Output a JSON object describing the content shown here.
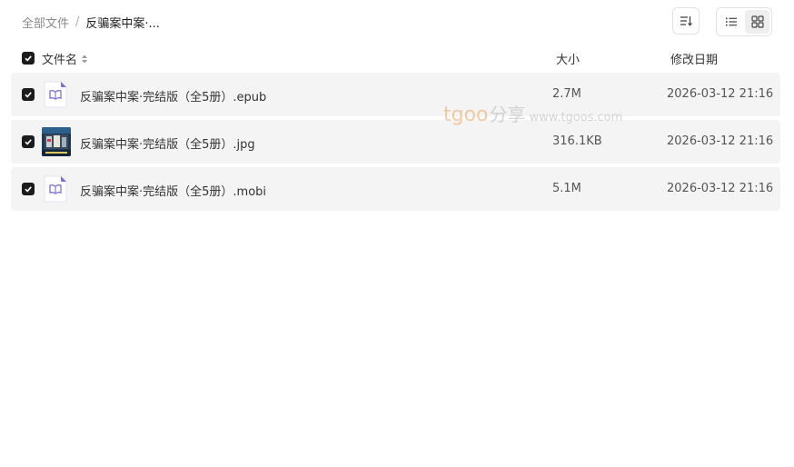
{
  "breadcrumb": {
    "root": "全部文件",
    "separator": "/",
    "current": "反骗案中案·..."
  },
  "toolbar": {
    "sort_icon": "sort-icon",
    "list_view_icon": "list-view-icon",
    "grid_view_icon": "grid-view-icon"
  },
  "header": {
    "name": "文件名",
    "size": "大小",
    "date": "修改日期"
  },
  "files": [
    {
      "name": "反骗案中案·完结版（全5册）.epub",
      "size": "2.7M",
      "modified": "2026-03-12 21:16",
      "icon": "ebook-file-icon"
    },
    {
      "name": "反骗案中案·完结版（全5册）.jpg",
      "size": "316.1KB",
      "modified": "2026-03-12 21:16",
      "icon": "image-thumbnail"
    },
    {
      "name": "反骗案中案·完结版（全5册）.mobi",
      "size": "5.1M",
      "modified": "2026-03-12 21:16",
      "icon": "ebook-file-icon"
    }
  ],
  "watermark": {
    "brand": "tgoo",
    "share": "分享",
    "url": "www.tgoos.com"
  },
  "colors": {
    "row_bg": "#f4f4f5",
    "checkbox": "#1c1c1c",
    "ebook_icon": "#7b6fd6"
  }
}
